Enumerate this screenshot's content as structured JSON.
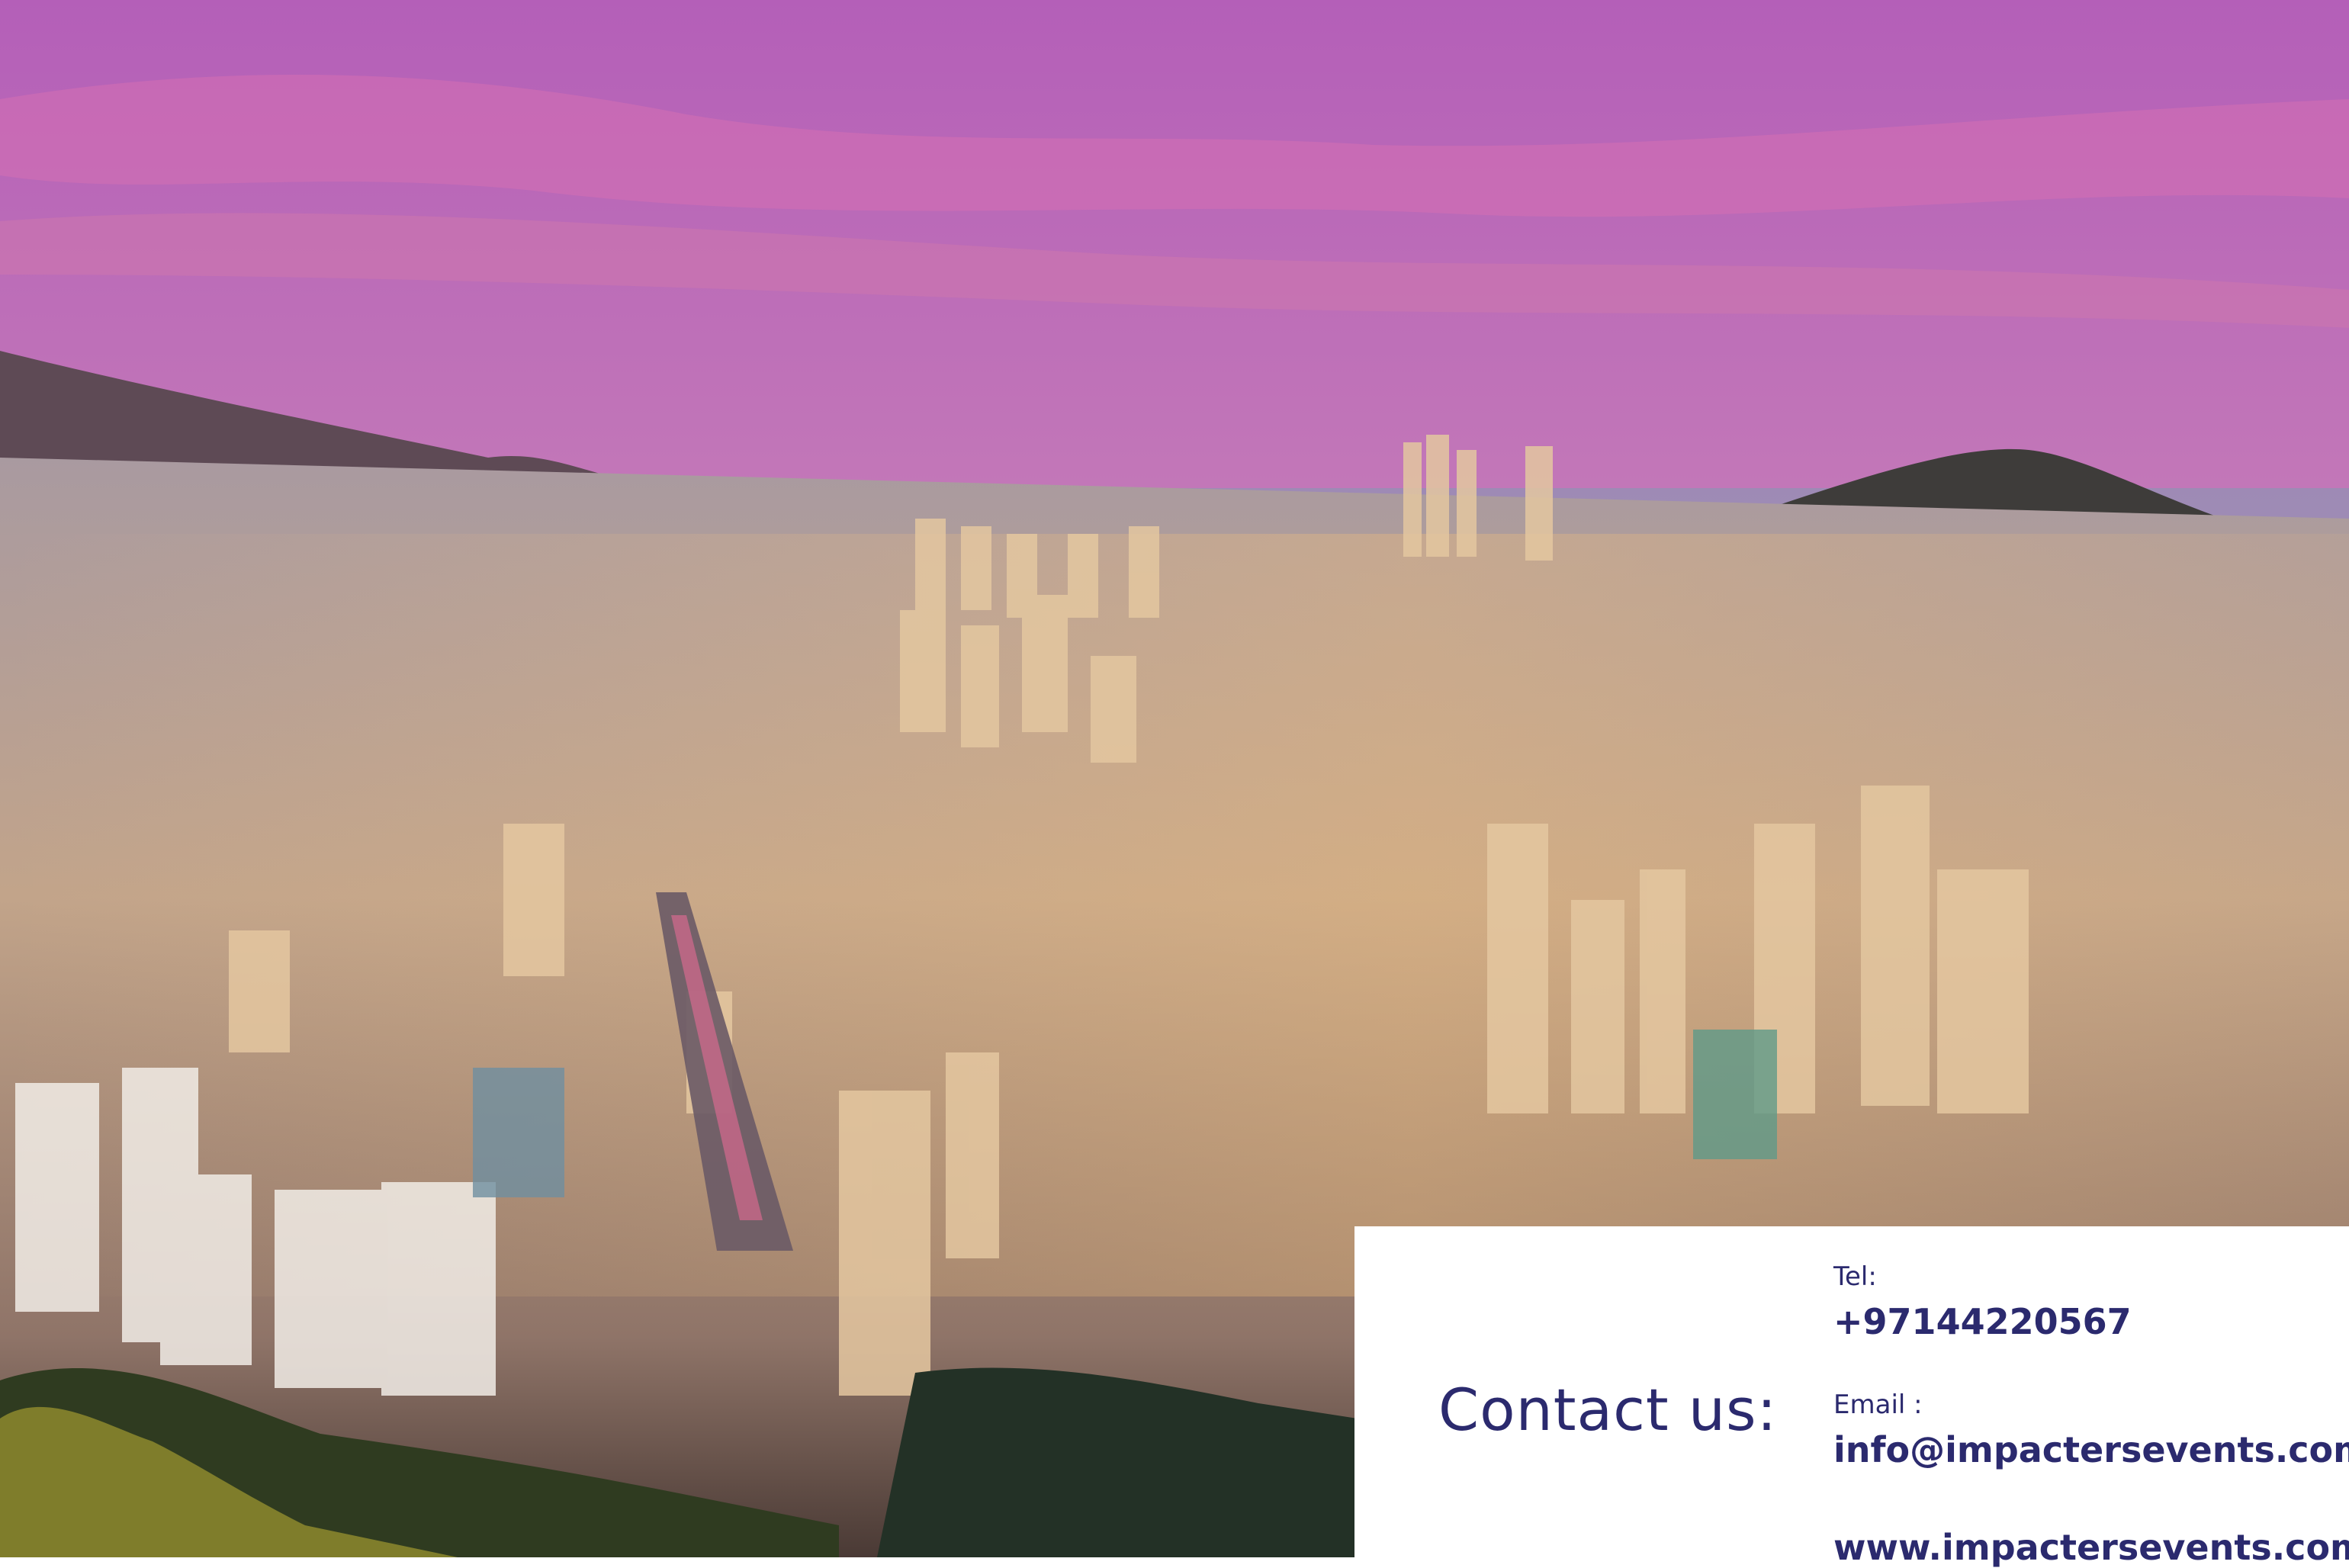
{
  "contact": {
    "heading": "Contact us:",
    "tel_label": "Tel:",
    "tel_value": "+97144220567",
    "email_label": "Email :",
    "email_value": "info@impactersevents.com",
    "website": "www.impactersevents.com"
  },
  "colors": {
    "brand_text": "#2b2a6e",
    "card_bg": "#ffffff"
  }
}
